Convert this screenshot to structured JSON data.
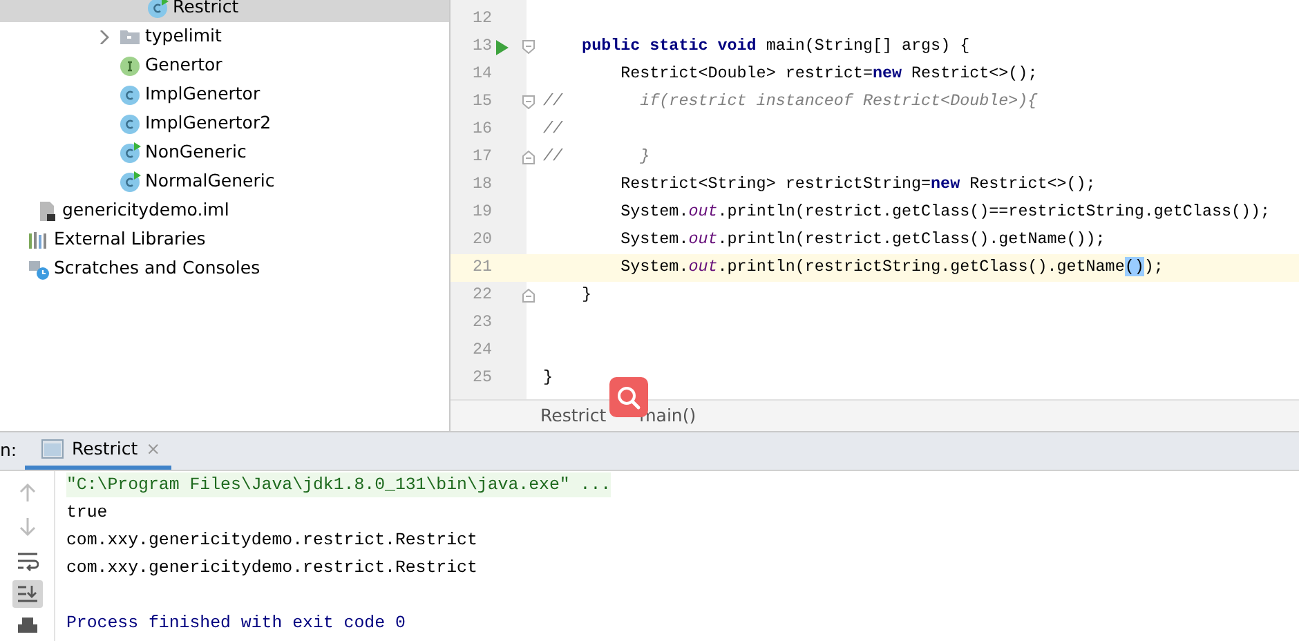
{
  "project_tree": [
    {
      "children": [
        {
          "children": [
            {
              "children": [
                {
                  "children": [
                    {
                      "children": [
                        {
                          "label": "Restrict",
                          "kind": "class-main",
                          "selected": true
                        }
                      ]
                    },
                    {
                      "label": "typelimit",
                      "kind": "folder",
                      "expanded": false,
                      "selected": false
                    },
                    {
                      "label": "Genertor",
                      "kind": "interface",
                      "selected": false
                    },
                    {
                      "label": "ImplGenertor",
                      "kind": "class",
                      "selected": false
                    },
                    {
                      "label": "ImplGenertor2",
                      "kind": "class",
                      "selected": false
                    },
                    {
                      "label": "NonGeneric",
                      "kind": "class-main",
                      "selected": false
                    },
                    {
                      "label": "NormalGeneric",
                      "kind": "class-main",
                      "selected": false
                    }
                  ]
                }
              ]
            }
          ]
        },
        {
          "label": "genericitydemo.iml",
          "kind": "file",
          "selected": false
        }
      ]
    },
    {
      "label": "External Libraries",
      "kind": "library",
      "selected": false
    },
    {
      "label": "Scratches and Consoles",
      "kind": "scratches",
      "selected": false
    }
  ],
  "editor": {
    "lines": [
      {
        "number": "12",
        "run": false,
        "fold_start": false,
        "fold_end": false,
        "current": false
      },
      {
        "number": "13",
        "run": true,
        "fold_start": true,
        "fold_end": false,
        "current": false,
        "tokens": [
          {
            "kind": "kw",
            "text": "    public static void "
          },
          {
            "kind": "plain",
            "text": "main(String[] args) {"
          }
        ]
      },
      {
        "number": "14",
        "run": false,
        "fold_start": false,
        "fold_end": false,
        "current": false,
        "tokens": [
          {
            "kind": "plain",
            "text": "        Restrict<Double> restrict="
          },
          {
            "kind": "kw",
            "text": "new "
          },
          {
            "kind": "plain",
            "text": "Restrict<>();"
          }
        ]
      },
      {
        "number": "15",
        "run": false,
        "fold_start": true,
        "fold_end": false,
        "current": false,
        "tokens": [
          {
            "kind": "comment",
            "text": "//        if(restrict instanceof Restrict<Double>){"
          }
        ]
      },
      {
        "number": "16",
        "run": false,
        "fold_start": false,
        "fold_end": false,
        "current": false,
        "tokens": [
          {
            "kind": "comment",
            "text": "//"
          }
        ]
      },
      {
        "number": "17",
        "run": false,
        "fold_start": false,
        "fold_end": true,
        "current": false,
        "tokens": [
          {
            "kind": "comment",
            "text": "//        }"
          }
        ]
      },
      {
        "number": "18",
        "run": false,
        "fold_start": false,
        "fold_end": false,
        "current": false,
        "tokens": [
          {
            "kind": "plain",
            "text": "        Restrict<String> restrictString="
          },
          {
            "kind": "kw",
            "text": "new "
          },
          {
            "kind": "plain",
            "text": "Restrict<>();"
          }
        ]
      },
      {
        "number": "19",
        "run": false,
        "fold_start": false,
        "fold_end": false,
        "current": false,
        "tokens": [
          {
            "kind": "plain",
            "text": "        System."
          },
          {
            "kind": "field",
            "text": "out"
          },
          {
            "kind": "plain",
            "text": ".println(restrict.getClass()==restrictString.getClass());"
          }
        ]
      },
      {
        "number": "20",
        "run": false,
        "fold_start": false,
        "fold_end": false,
        "current": false,
        "tokens": [
          {
            "kind": "plain",
            "text": "        System."
          },
          {
            "kind": "field",
            "text": "out"
          },
          {
            "kind": "plain",
            "text": ".println(restrict.getClass().getName());"
          }
        ]
      },
      {
        "number": "21",
        "run": false,
        "fold_start": false,
        "fold_end": false,
        "current": true,
        "tokens": [
          {
            "kind": "plain",
            "text": "        System."
          },
          {
            "kind": "field",
            "text": "out"
          },
          {
            "kind": "plain",
            "text": ".println(restrictString.getClass().getName"
          },
          {
            "kind": "match",
            "text": "()"
          },
          {
            "kind": "plain",
            "text": ");"
          }
        ]
      },
      {
        "number": "22",
        "run": false,
        "fold_start": false,
        "fold_end": true,
        "current": false,
        "tokens": [
          {
            "kind": "plain",
            "text": "    }"
          }
        ]
      },
      {
        "number": "23",
        "run": false,
        "fold_start": false,
        "fold_end": false,
        "current": false
      },
      {
        "number": "24",
        "run": false,
        "fold_start": false,
        "fold_end": false,
        "current": false
      },
      {
        "number": "25",
        "run": false,
        "fold_start": false,
        "fold_end": false,
        "current": false,
        "tokens": [
          {
            "kind": "plain",
            "text": "}"
          }
        ]
      }
    ],
    "breadcrumbs": [
      "Restrict",
      "main()"
    ]
  },
  "run_panel": {
    "label": "n:",
    "tabs": [
      {
        "label": "Restrict",
        "selected": true,
        "close": "×"
      }
    ],
    "toolbar": [
      {
        "disabled": true,
        "pressed": false
      },
      {
        "disabled": true,
        "pressed": false
      },
      {
        "disabled": false,
        "pressed": false
      },
      {
        "disabled": false,
        "pressed": true
      },
      {
        "disabled": false,
        "pressed": false
      }
    ],
    "output": [
      {
        "kind": "command",
        "text": "\"C:\\Program Files\\Java\\jdk1.8.0_131\\bin\\java.exe\" ..."
      },
      {
        "kind": "stdout",
        "text": "true"
      },
      {
        "kind": "stdout",
        "text": "com.xxy.genericitydemo.restrict.Restrict"
      },
      {
        "kind": "stdout",
        "text": "com.xxy.genericitydemo.restrict.Restrict"
      },
      {
        "kind": "blank"
      },
      {
        "kind": "system",
        "text": "Process finished with exit code 0"
      }
    ]
  }
}
